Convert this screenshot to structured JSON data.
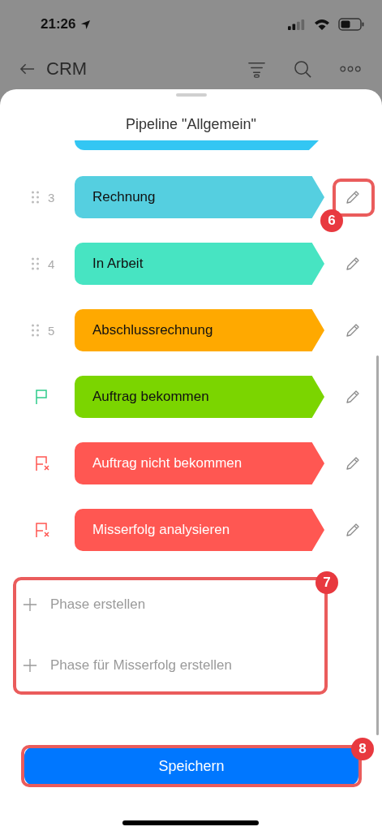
{
  "status_bar": {
    "time": "21:26"
  },
  "header": {
    "title": "CRM"
  },
  "sheet": {
    "title": "Pipeline \"Allgemein\""
  },
  "stages": [
    {
      "kind": "cut",
      "color": "#33c6f3"
    },
    {
      "kind": "step",
      "number": "3",
      "label": "Rechnung",
      "color": "#55cfe0"
    },
    {
      "kind": "step",
      "number": "4",
      "label": "In Arbeit",
      "color": "#47e4c2"
    },
    {
      "kind": "step",
      "number": "5",
      "label": "Abschlussrechnung",
      "color": "#ffa900"
    },
    {
      "kind": "success",
      "label": "Auftrag bekommen",
      "color": "#7bd500"
    },
    {
      "kind": "failure",
      "label": "Auftrag nicht bekommen",
      "color": "#ff5752"
    },
    {
      "kind": "failure",
      "label": "Misserfolg analysieren",
      "color": "#ff5752"
    }
  ],
  "add_actions": [
    "Phase erstellen",
    "Phase für Misserfolg erstellen"
  ],
  "save_button": "Speichern",
  "callouts": [
    {
      "number": "6"
    },
    {
      "number": "7"
    },
    {
      "number": "8"
    }
  ]
}
